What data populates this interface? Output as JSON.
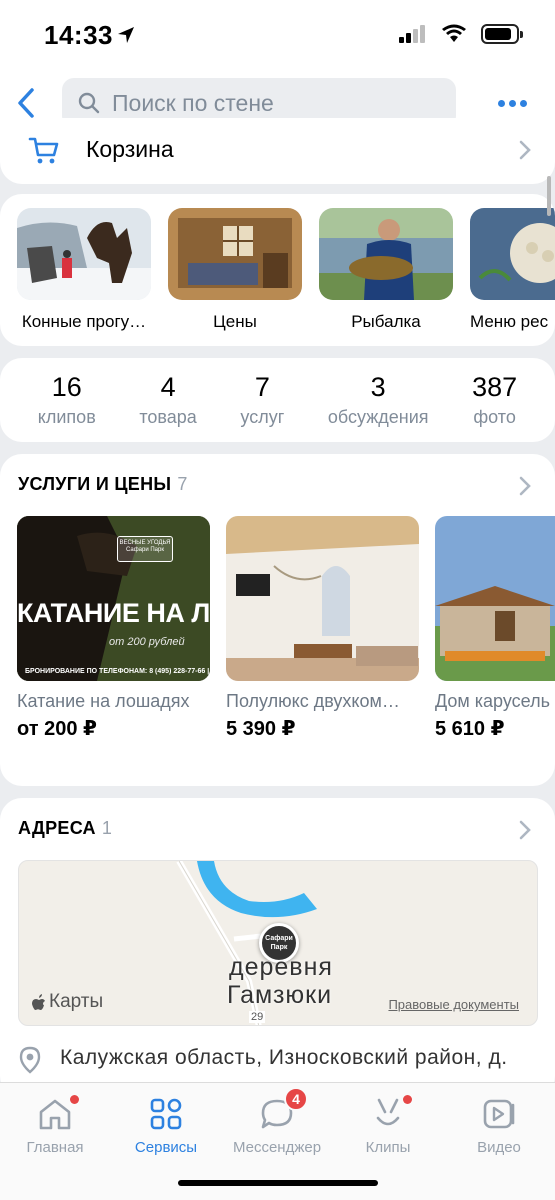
{
  "status": {
    "time": "14:33"
  },
  "search": {
    "placeholder": "Поиск по стене"
  },
  "cart": {
    "label": "Корзина"
  },
  "stories": [
    {
      "label": "Конные прогу…"
    },
    {
      "label": "Цены"
    },
    {
      "label": "Рыбалка"
    },
    {
      "label": "Меню рес"
    }
  ],
  "counters": [
    {
      "num": "16",
      "label": "клипов"
    },
    {
      "num": "4",
      "label": "товара"
    },
    {
      "num": "7",
      "label": "услуг"
    },
    {
      "num": "3",
      "label": "обсуждения"
    },
    {
      "num": "387",
      "label": "фото"
    }
  ],
  "services": {
    "title": "УСЛУГИ И ЦЕНЫ",
    "count": "7",
    "items": [
      {
        "name": "Катание на лошадях",
        "price": "от 200 ₽",
        "banner_title": "КАТАНИЕ НА ЛОШ",
        "banner_sub": "от 200 рублей",
        "banner_phone": "БРОНИРОВАНИЕ ПО ТЕЛЕФОНАМ: 8 (495) 228-77-66 | 8",
        "logo_top": "ВЕСНЫЕ УГОДЬЯ",
        "logo_bottom": "Сафари Парк"
      },
      {
        "name": "Полулюкс двухком…",
        "price": "5 390 ₽"
      },
      {
        "name": "Дом карусель",
        "price": "5 610 ₽"
      }
    ]
  },
  "addresses": {
    "title": "АДРЕСА",
    "count": "1",
    "map_place": "деревня",
    "map_place2": "Гамзюки",
    "map_brand": "Карты",
    "map_legal": "Правовые документы",
    "map_road": "29",
    "pin_text": "Сафари Парк",
    "address": "Калужская область, Износковский район, д."
  },
  "tabs": [
    {
      "label": "Главная"
    },
    {
      "label": "Сервисы"
    },
    {
      "label": "Мессенджер",
      "badge": "4"
    },
    {
      "label": "Клипы"
    },
    {
      "label": "Видео"
    }
  ],
  "colors": {
    "accent": "#2d81e0",
    "badge": "#e64646",
    "background": "#ebedf0"
  }
}
